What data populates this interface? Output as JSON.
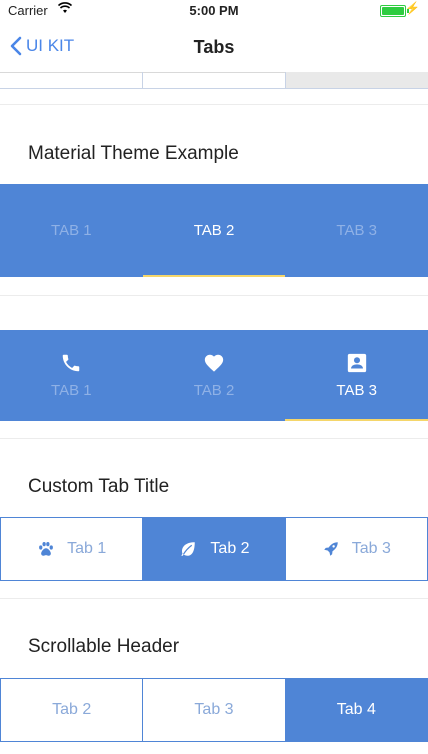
{
  "status_bar": {
    "carrier": "Carrier",
    "time": "5:00 PM"
  },
  "nav": {
    "back_label": "UI KIT",
    "title": "Tabs"
  },
  "sections": {
    "material_title": "Material Theme Example",
    "custom_title": "Custom Tab Title",
    "scrollable_title": "Scrollable Header"
  },
  "material_tabs": {
    "labels": [
      "TAB 1",
      "TAB 2",
      "TAB 3"
    ],
    "active_index": 1
  },
  "icon_tabs": {
    "labels": [
      "TAB 1",
      "TAB 2",
      "TAB 3"
    ],
    "icons": [
      "phone-icon",
      "heart-icon",
      "contact-card-icon"
    ],
    "active_index": 2
  },
  "custom_tabs": {
    "labels": [
      "Tab 1",
      "Tab 2",
      "Tab 3"
    ],
    "icons": [
      "paw-icon",
      "leaf-icon",
      "rocket-icon"
    ],
    "active_index": 1
  },
  "scrollable_tabs": {
    "labels": [
      "Tab 2",
      "Tab 3",
      "Tab 4"
    ],
    "active_index": 2
  },
  "colors": {
    "accent": "#4f85d6",
    "indicator": "#f5d66a",
    "link": "#4a86e8"
  }
}
